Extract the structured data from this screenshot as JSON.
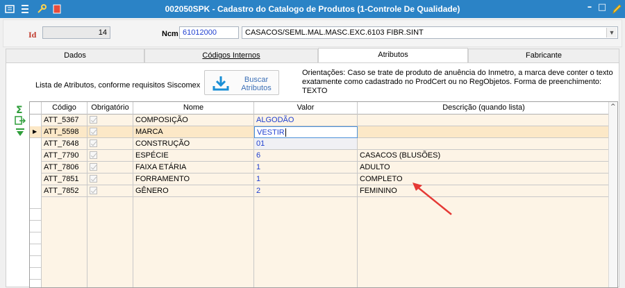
{
  "window": {
    "title": "002050SPK - Cadastro do Catalogo de Produtos (1-Controle De Qualidade)",
    "min_icon": "minimize-icon",
    "max_icon": "maximize-icon",
    "pencil_icon": "pencil-icon"
  },
  "header": {
    "id_label": "Id",
    "id_value": "14",
    "ncm_label": "Ncm",
    "ncm_code": "61012000",
    "ncm_description": "CASACOS/SEML.MAL.MASC.EXC.6103 FIBR.SINT"
  },
  "tabs": [
    {
      "label": "Dados"
    },
    {
      "label": "Códigos Internos"
    },
    {
      "label": "Atributos"
    },
    {
      "label": "Fabricante"
    }
  ],
  "atributos": {
    "lista_label": "Lista de Atributos, conforme requisitos Siscomex",
    "buscar_button_line1": "Buscar",
    "buscar_button_line2": "Atributos",
    "orientacoes": "Orientações: Caso se trate de produto de anuência do Inmetro, a marca deve conter o texto exatamente como cadastrado no ProdCert ou no RegObjetos. Forma de preenchimento: TEXTO"
  },
  "grid": {
    "columns": [
      "Código",
      "Obrigatório",
      "Nome",
      "Valor",
      "Descrição (quando lista)"
    ],
    "rows": [
      {
        "codigo": "ATT_5367",
        "nome": "COMPOSIÇÃO",
        "valor": "ALGODÃO",
        "descricao": ""
      },
      {
        "codigo": "ATT_5598",
        "nome": "MARCA",
        "valor": "VESTIR",
        "descricao": ""
      },
      {
        "codigo": "ATT_7648",
        "nome": "CONSTRUÇÃO",
        "valor": "01",
        "descricao": ""
      },
      {
        "codigo": "ATT_7790",
        "nome": "ESPÉCIE",
        "valor": "6",
        "descricao": "CASACOS (BLUSÕES)"
      },
      {
        "codigo": "ATT_7806",
        "nome": "FAIXA ETÁRIA",
        "valor": "1",
        "descricao": "ADULTO"
      },
      {
        "codigo": "ATT_7851",
        "nome": "FORRAMENTO",
        "valor": "1",
        "descricao": "COMPLETO"
      },
      {
        "codigo": "ATT_7852",
        "nome": "GÊNERO",
        "valor": "2",
        "descricao": "FEMININO"
      }
    ]
  },
  "colors": {
    "titlebar": "#2b83c6",
    "grid_bg": "#fdf4e6",
    "value_blue": "#1f3fd0",
    "annotation_arrow": "#e53935"
  }
}
